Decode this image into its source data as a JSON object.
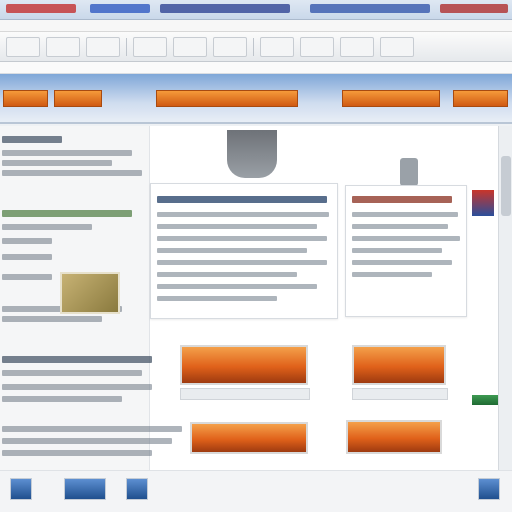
{
  "window": {
    "title": ""
  },
  "toolbar": {
    "buttons": [
      "",
      "",
      "",
      "",
      "",
      "",
      "",
      "",
      "",
      ""
    ]
  },
  "banner": {
    "tabs": [
      "",
      "",
      "",
      "",
      ""
    ]
  },
  "promos": [
    "",
    "",
    "",
    ""
  ],
  "colors": {
    "accent": "#e0611a",
    "banner": "#7fa7d8",
    "link": "#203d66"
  },
  "icons": {
    "flag": "flag-icon",
    "portrait": "portrait-image",
    "mug": "mug-image"
  }
}
